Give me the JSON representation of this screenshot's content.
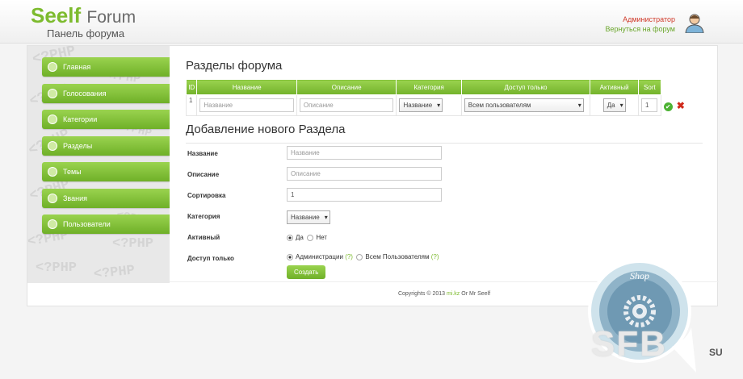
{
  "header": {
    "logo_part1": "Seelf",
    "logo_part2": "Forum",
    "subtitle": "Панель форума",
    "user_role": "Администратор",
    "back_link": "Вернуться на форум"
  },
  "sidebar": {
    "bg_text": "<?PHP",
    "items": [
      {
        "label": "Главная"
      },
      {
        "label": "Голосования"
      },
      {
        "label": "Категории"
      },
      {
        "label": "Разделы"
      },
      {
        "label": "Темы"
      },
      {
        "label": "Звания"
      },
      {
        "label": "Пользователи"
      }
    ]
  },
  "sections": {
    "title": "Разделы форума",
    "columns": [
      "ID",
      "Название",
      "Описание",
      "Категория",
      "Доступ только",
      "Активный",
      "Sort"
    ],
    "rows": [
      {
        "id": "1",
        "name_placeholder": "Название",
        "desc_placeholder": "Описание",
        "category": "Название",
        "access": "Всем пользователям",
        "active": "Да",
        "sort": "1"
      }
    ]
  },
  "add_form": {
    "title": "Добавление нового Раздела",
    "name_label": "Название",
    "name_placeholder": "Название",
    "desc_label": "Описание",
    "desc_placeholder": "Описание",
    "sort_label": "Сортировка",
    "sort_value": "1",
    "category_label": "Категория",
    "category_value": "Название",
    "active_label": "Активный",
    "active_yes": "Да",
    "active_no": "Нет",
    "access_label": "Доступ только",
    "access_admin": "Администрации",
    "access_all": "Всем Пользователям",
    "hint": "(?)",
    "submit_label": "Создать"
  },
  "footer": {
    "prefix": "Copyrights © 2013",
    "link": "mi.kz",
    "suffix": "Or Mr Seelf"
  },
  "watermark": {
    "shop": "Shop",
    "text": "SFB",
    "suffix": "SU"
  }
}
